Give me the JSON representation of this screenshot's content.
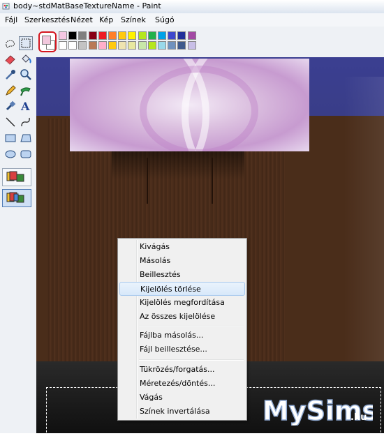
{
  "window": {
    "title": "body~stdMatBaseTextureName - Paint",
    "app_icon": "paint-icon"
  },
  "menubar": {
    "items": [
      "Fájl",
      "Szerkesztés",
      "Nézet",
      "Kép",
      "Színek",
      "Súgó"
    ]
  },
  "toolbox": {
    "tools": [
      {
        "name": "free-select-icon"
      },
      {
        "name": "rect-select-icon",
        "selected": true
      },
      {
        "name": "eraser-icon"
      },
      {
        "name": "fill-bucket-icon"
      },
      {
        "name": "color-picker-icon"
      },
      {
        "name": "magnifier-icon"
      },
      {
        "name": "pencil-icon"
      },
      {
        "name": "brush-icon"
      },
      {
        "name": "airbrush-icon"
      },
      {
        "name": "text-icon",
        "glyph": "A"
      },
      {
        "name": "line-icon"
      },
      {
        "name": "curve-icon"
      },
      {
        "name": "rectangle-icon"
      },
      {
        "name": "polygon-icon"
      },
      {
        "name": "ellipse-icon"
      },
      {
        "name": "rounded-rect-icon"
      }
    ]
  },
  "palette": {
    "primary_color": "#f2c8dd",
    "secondary_color": "#ffffff",
    "top_row": [
      "#f4c7e2",
      "#000000",
      "#7f7f7f",
      "#880015",
      "#ed1c24",
      "#ff7f27",
      "#ffc90e",
      "#fff200",
      "#b5e61d",
      "#22b14c",
      "#00a2e8",
      "#3f48cc",
      "#22309a",
      "#a349a4"
    ],
    "bottom_row": [
      "#ffffff",
      "#ffffff",
      "#c3c3c3",
      "#b97a57",
      "#ffaec9",
      "#ffc90e",
      "#efe4b0",
      "#e8e8a0",
      "#c8e8a8",
      "#b5e61d",
      "#99d9ea",
      "#7092be",
      "#3f5a8c",
      "#c8bfe7"
    ]
  },
  "context_menu": {
    "groups": [
      [
        {
          "label": "Kivágás"
        },
        {
          "label": "Másolás"
        },
        {
          "label": "Beillesztés"
        },
        {
          "label": "Kijelölés törlése",
          "highlighted": true
        },
        {
          "label": "Kijelölés megfordítása"
        },
        {
          "label": "Az összes kijelölése"
        }
      ],
      [
        {
          "label": "Fájlba másolás..."
        },
        {
          "label": "Fájl beillesztése..."
        }
      ],
      [
        {
          "label": "Tükrözés/forgatás..."
        },
        {
          "label": "Méretezés/döntés..."
        },
        {
          "label": "Vágás"
        },
        {
          "label": "Színek invertálása"
        }
      ]
    ]
  },
  "watermark": {
    "text": "MySims",
    "suffix": ".hu"
  }
}
